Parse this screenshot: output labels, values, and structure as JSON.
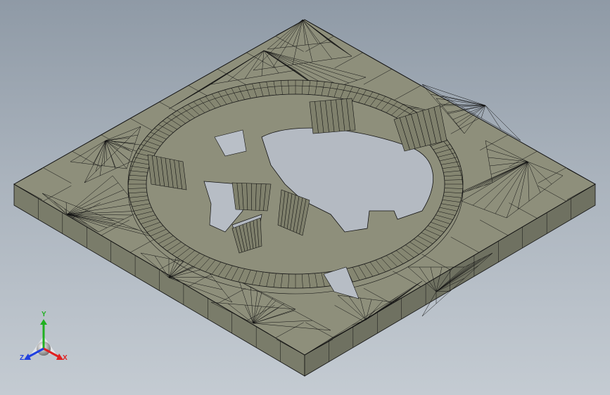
{
  "viewport": {
    "colors": {
      "top_face": "#8e8f7b",
      "front_left_face": "#7a7c6a",
      "front_right_face": "#6f7161",
      "mesh_edges": "#111111",
      "background_top": "#8f9aa6",
      "background_bottom": "#c4cbd2"
    }
  },
  "triad": {
    "x_label": "X",
    "y_label": "Y",
    "z_label": "Z",
    "colors": {
      "x": "#e02020",
      "y": "#20b020",
      "z": "#2040e0"
    }
  }
}
